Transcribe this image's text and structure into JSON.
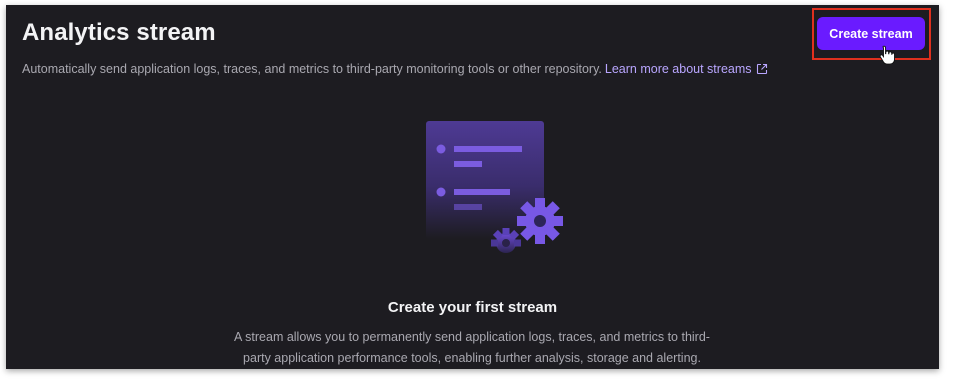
{
  "header": {
    "title": "Analytics stream",
    "subtitle": "Automatically send application logs, traces, and metrics to third-party monitoring tools or other repository.",
    "learn_more_label": "Learn more about streams",
    "create_button_label": "Create stream"
  },
  "empty_state": {
    "title": "Create your first stream",
    "description": "A stream allows you to permanently send application logs, traces, and metrics to third-party application performance tools, enabling further analysis, storage and alerting."
  },
  "icons": {
    "external_link": "external-link-icon",
    "cursor": "hand-pointer-icon",
    "illustration": "stream-gear-illustration"
  },
  "colors": {
    "background": "#1d1c21",
    "accent": "#6a1bff",
    "link": "#b9a6ff",
    "highlight": "#e0301e"
  }
}
